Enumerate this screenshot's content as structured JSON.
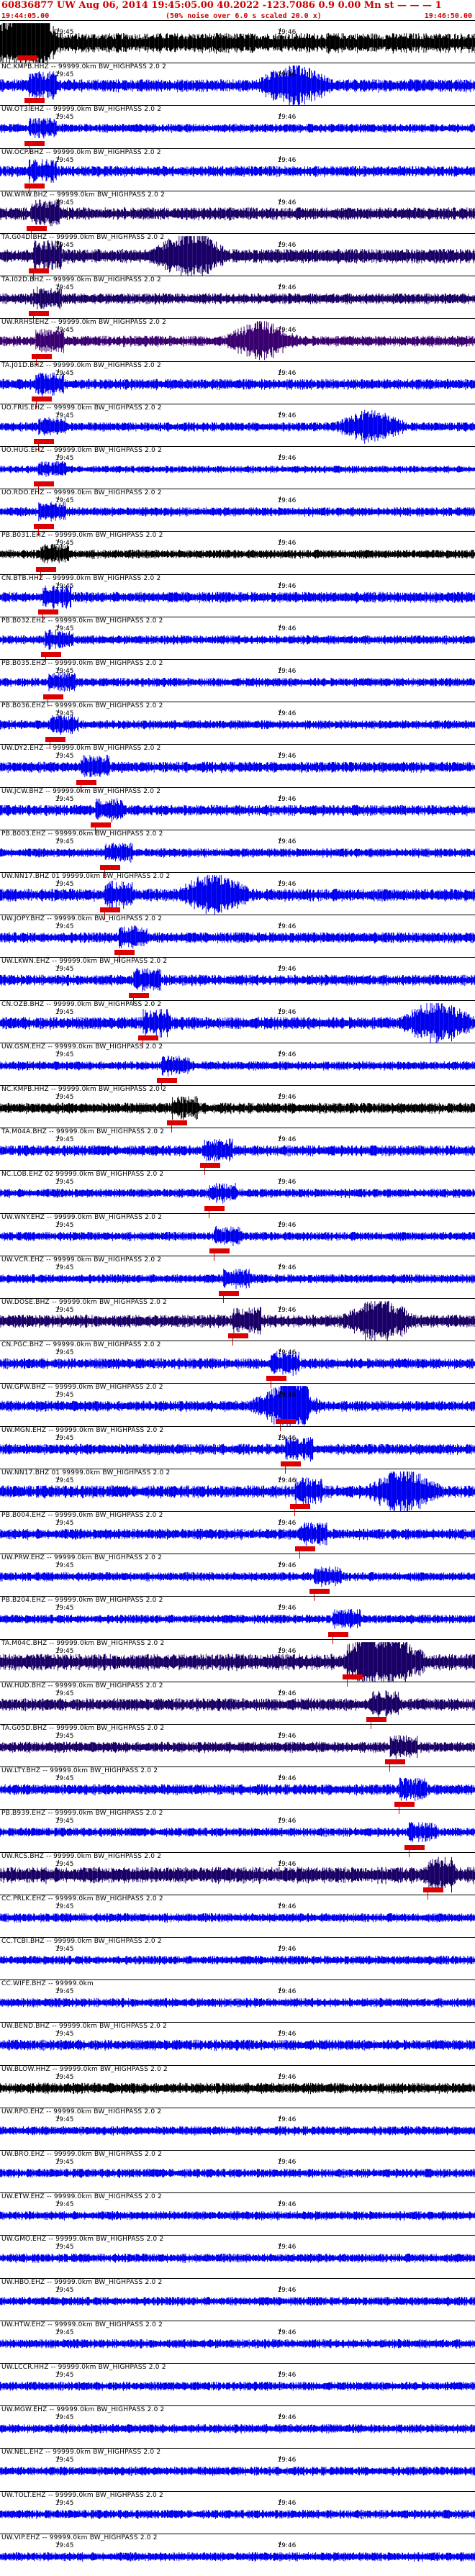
{
  "header": {
    "title": "60836877 UW Aug 06, 2014 19:45:05.00   40.2022 -123.7086  0.9 0.00 Mn st — — — 1",
    "start_time": "19:44:05.00",
    "note": "(50% noise over 6.0 s scaled 20.0 x)",
    "end_time": "19:46:50.00"
  },
  "tick_labels": {
    "first": "19:45",
    "second": "19:46"
  },
  "colors": {
    "black": "#000000",
    "blue": "#0000ee",
    "navy": "#1a0066",
    "purple": "#3a0070",
    "pick": "#dd0000"
  },
  "traces": [
    {
      "label": "",
      "color": "black",
      "amp": 0.55,
      "burst": 0.05,
      "pick": 0.045
    },
    {
      "label": "NC.KMPB.HHZ -- 99999.0km BW_HIGHPASS  2.0  2",
      "color": "blue",
      "amp": 0.35,
      "burst": 0.62,
      "pick": 0.06
    },
    {
      "label": "UW.OT3.EHZ -- 99999.0km BW_HIGHPASS  2.0  2",
      "color": "blue",
      "amp": 0.25,
      "burst": 0.0,
      "pick": 0.06
    },
    {
      "label": "UW.OCP.BHZ -- 99999.0km BW_HIGHPASS  2.0  2",
      "color": "blue",
      "amp": 0.3,
      "burst": 0.0,
      "pick": 0.06
    },
    {
      "label": "UW.WRW.BHZ -- 99999.0km BW_HIGHPASS  2.0  2",
      "color": "navy",
      "amp": 0.35,
      "burst": 0.0,
      "pick": 0.065
    },
    {
      "label": "TA.G04D.BHZ -- 99999.0km BW_HIGHPASS  2.0  2",
      "color": "navy",
      "amp": 0.4,
      "burst": 0.4,
      "pick": 0.07
    },
    {
      "label": "TA.I02D.BHZ -- 99999.0km BW_HIGHPASS  2.0  2",
      "color": "navy",
      "amp": 0.3,
      "burst": 0.0,
      "pick": 0.07
    },
    {
      "label": "UW.RRHS.EHZ -- 99999.0km BW_HIGHPASS  2.0  2",
      "color": "purple",
      "amp": 0.3,
      "burst": 0.55,
      "pick": 0.075
    },
    {
      "label": "TA.J01D.BHZ -- 99999.0km BW_HIGHPASS  2.0  2",
      "color": "blue",
      "amp": 0.3,
      "burst": 0.0,
      "pick": 0.075
    },
    {
      "label": "UO.FRIS.EHZ -- 99999.0km BW_HIGHPASS  2.0  2",
      "color": "blue",
      "amp": 0.25,
      "burst": 0.78,
      "pick": 0.08
    },
    {
      "label": "UO.HUG.EHZ -- 99999.0km BW_HIGHPASS  2.0  2",
      "color": "blue",
      "amp": 0.2,
      "burst": 0.0,
      "pick": 0.08
    },
    {
      "label": "UO.RDO.EHZ -- 99999.0km BW_HIGHPASS  2.0  2",
      "color": "blue",
      "amp": 0.25,
      "burst": 0.0,
      "pick": 0.08
    },
    {
      "label": "PB.B031.EHZ -- 99999.0km BW_HIGHPASS  2.0  2",
      "color": "black",
      "amp": 0.25,
      "burst": 0.0,
      "pick": 0.085
    },
    {
      "label": "CN.BTB.HHZ -- 99999.0km BW_HIGHPASS  2.0  2",
      "color": "blue",
      "amp": 0.3,
      "burst": 0.0,
      "pick": 0.09
    },
    {
      "label": "PB.B032.EHZ -- 99999.0km BW_HIGHPASS  2.0  2",
      "color": "blue",
      "amp": 0.25,
      "burst": 0.0,
      "pick": 0.095
    },
    {
      "label": "PB.B035.EHZ -- 99999.0km BW_HIGHPASS  2.0  2",
      "color": "blue",
      "amp": 0.25,
      "burst": 0.0,
      "pick": 0.1
    },
    {
      "label": "PB.B036.EHZ -- 99999.0km BW_HIGHPASS  2.0  2",
      "color": "blue",
      "amp": 0.25,
      "burst": 0.0,
      "pick": 0.105
    },
    {
      "label": "UW.DY2.EHZ -- 99999.0km BW_HIGHPASS  2.0  2",
      "color": "blue",
      "amp": 0.3,
      "burst": 0.0,
      "pick": 0.17
    },
    {
      "label": "UW.JCW.BHZ -- 99999.0km BW_HIGHPASS  2.0  2",
      "color": "blue",
      "amp": 0.3,
      "burst": 0.0,
      "pick": 0.2
    },
    {
      "label": "PB.B003.EHZ -- 99999.0km BW_HIGHPASS  2.0  2",
      "color": "blue",
      "amp": 0.25,
      "burst": 0.0,
      "pick": 0.22
    },
    {
      "label": "UW.NN17.BHZ 01 99999.0km BW_HIGHPASS  2.0  2",
      "color": "blue",
      "amp": 0.35,
      "burst": 0.45,
      "pick": 0.22
    },
    {
      "label": "UW.JOPY.BHZ -- 99999.0km BW_HIGHPASS  2.0  2",
      "color": "blue",
      "amp": 0.3,
      "burst": 0.0,
      "pick": 0.25
    },
    {
      "label": "UW.LKWN.EHZ -- 99999.0km BW_HIGHPASS  2.0  2",
      "color": "blue",
      "amp": 0.3,
      "burst": 0.0,
      "pick": 0.28
    },
    {
      "label": "CN.OZB.BHZ -- 99999.0km BW_HIGHPASS  2.0  2",
      "color": "blue",
      "amp": 0.35,
      "burst": 0.92,
      "pick": 0.3
    },
    {
      "label": "UW.GSM.EHZ -- 99999.0km BW_HIGHPASS  2.0  2",
      "color": "blue",
      "amp": 0.25,
      "burst": 0.0,
      "pick": 0.34
    },
    {
      "label": "NC.KMPB.HHZ -- 99999.0km BW_HIGHPASS  2.0  2",
      "color": "black",
      "amp": 0.3,
      "burst": 0.0,
      "pick": 0.36
    },
    {
      "label": "TA.M04A.BHZ -- 99999.0km BW_HIGHPASS  2.0  2",
      "color": "blue",
      "amp": 0.3,
      "burst": 0.0,
      "pick": 0.43
    },
    {
      "label": "NC.LOB.EHZ 02 99999.0km BW_HIGHPASS  2.0  2",
      "color": "blue",
      "amp": 0.25,
      "burst": 0.0,
      "pick": 0.44
    },
    {
      "label": "UW.WNY.EHZ -- 99999.0km BW_HIGHPASS  2.0  2",
      "color": "blue",
      "amp": 0.25,
      "burst": 0.0,
      "pick": 0.45
    },
    {
      "label": "UW.VCR.EHZ -- 99999.0km BW_HIGHPASS  2.0  2",
      "color": "blue",
      "amp": 0.25,
      "burst": 0.0,
      "pick": 0.47
    },
    {
      "label": "UW.DOSE.BHZ -- 99999.0km BW_HIGHPASS  2.0  2",
      "color": "navy",
      "amp": 0.35,
      "burst": 0.8,
      "pick": 0.49
    },
    {
      "label": "CN.PGC.BHZ -- 99999.0km BW_HIGHPASS  2.0  2",
      "color": "blue",
      "amp": 0.3,
      "burst": 0.0,
      "pick": 0.57
    },
    {
      "label": "UW.GPW.BHZ -- 99999.0km BW_HIGHPASS  2.0  2",
      "color": "blue",
      "amp": 0.3,
      "burst": 0.6,
      "pick": 0.59
    },
    {
      "label": "UW.MGN.EHZ -- 99999.0km BW_HIGHPASS  2.0  2",
      "color": "blue",
      "amp": 0.3,
      "burst": 0.0,
      "pick": 0.6
    },
    {
      "label": "UW.NN17.BHZ 01 99999.0km BW_HIGHPASS  2.0  2",
      "color": "blue",
      "amp": 0.35,
      "burst": 0.85,
      "pick": 0.62
    },
    {
      "label": "PB.B004.EHZ -- 99999.0km BW_HIGHPASS  2.0  2",
      "color": "blue",
      "amp": 0.3,
      "burst": 0.0,
      "pick": 0.63
    },
    {
      "label": "UW.PRW.EHZ -- 99999.0km BW_HIGHPASS  2.0  2",
      "color": "blue",
      "amp": 0.25,
      "burst": 0.0,
      "pick": 0.66
    },
    {
      "label": "PB.B204.EHZ -- 99999.0km BW_HIGHPASS  2.0  2",
      "color": "blue",
      "amp": 0.25,
      "burst": 0.0,
      "pick": 0.7
    },
    {
      "label": "TA.M04C.BHZ -- 99999.0km BW_HIGHPASS  2.0  2",
      "color": "navy",
      "amp": 0.45,
      "burst": 0.82,
      "pick": 0.73
    },
    {
      "label": "UW.HUD.BHZ -- 99999.0km BW_HIGHPASS  2.0  2",
      "color": "navy",
      "amp": 0.35,
      "burst": 0.0,
      "pick": 0.78
    },
    {
      "label": "TA.G05D.BHZ -- 99999.0km BW_HIGHPASS  2.0  2",
      "color": "navy",
      "amp": 0.3,
      "burst": 0.0,
      "pick": 0.82
    },
    {
      "label": "UW.LTY.BHZ -- 99999.0km BW_HIGHPASS  2.0  2",
      "color": "blue",
      "amp": 0.3,
      "burst": 0.0,
      "pick": 0.84
    },
    {
      "label": "PB.B939.EHZ -- 99999.0km BW_HIGHPASS  2.0  2",
      "color": "blue",
      "amp": 0.25,
      "burst": 0.0,
      "pick": 0.86
    },
    {
      "label": "UW.RCS.BHZ -- 99999.0km BW_HIGHPASS  2.0  2",
      "color": "navy",
      "amp": 0.45,
      "burst": 0.0,
      "pick": 0.9
    },
    {
      "label": "CC.PRLK.EHZ -- 99999.0km BW_HIGHPASS  2.0  2",
      "color": "blue",
      "amp": 0.25,
      "burst": 0.0,
      "pick": -1
    },
    {
      "label": "CC.TCBI.BHZ -- 99999.0km BW_HIGHPASS  2.0  2",
      "color": "blue",
      "amp": 0.25,
      "burst": 0.0,
      "pick": -1
    },
    {
      "label": "CC.WIFE.BHZ -- 99999.0km",
      "color": "blue",
      "amp": 0.25,
      "burst": 0.0,
      "pick": -1
    },
    {
      "label": "UW.BEND.BHZ -- 99999.0km BW_HIGHPASS  2.0  2",
      "color": "blue",
      "amp": 0.3,
      "burst": 0.0,
      "pick": -1
    },
    {
      "label": "UW.BLOW.HHZ -- 99999.0km BW_HIGHPASS  2.0  2",
      "color": "black",
      "amp": 0.3,
      "burst": 0.0,
      "pick": -1
    },
    {
      "label": "UW.RPO.EHZ -- 99999.0km BW_HIGHPASS  2.0  2",
      "color": "blue",
      "amp": 0.25,
      "burst": 0.0,
      "pick": -1
    },
    {
      "label": "UW.BRO.EHZ -- 99999.0km BW_HIGHPASS  2.0  2",
      "color": "blue",
      "amp": 0.25,
      "burst": 0.0,
      "pick": -1
    },
    {
      "label": "UW.ETW.EHZ -- 99999.0km BW_HIGHPASS  2.0  2",
      "color": "blue",
      "amp": 0.25,
      "burst": 0.0,
      "pick": -1
    },
    {
      "label": "UW.GMO.EHZ -- 99999.0km BW_HIGHPASS  2.0  2",
      "color": "blue",
      "amp": 0.25,
      "burst": 0.0,
      "pick": -1
    },
    {
      "label": "UW.HBO.EHZ -- 99999.0km BW_HIGHPASS  2.0  2",
      "color": "blue",
      "amp": 0.25,
      "burst": 0.0,
      "pick": -1
    },
    {
      "label": "UW.HTW.EHZ -- 99999.0km BW_HIGHPASS  2.0  2",
      "color": "blue",
      "amp": 0.25,
      "burst": 0.0,
      "pick": -1
    },
    {
      "label": "UW.LCCR.HHZ -- 99999.0km BW_HIGHPASS  2.0  2",
      "color": "blue",
      "amp": 0.25,
      "burst": 0.0,
      "pick": -1
    },
    {
      "label": "UW.MGW.EHZ -- 99999.0km BW_HIGHPASS  2.0  2",
      "color": "blue",
      "amp": 0.25,
      "burst": 0.0,
      "pick": -1
    },
    {
      "label": "UW.NEL.EHZ -- 99999.0km BW_HIGHPASS  2.0  2",
      "color": "blue",
      "amp": 0.25,
      "burst": 0.0,
      "pick": -1
    },
    {
      "label": "UW.TOLT.EHZ -- 99999.0km BW_HIGHPASS  2.0  2",
      "color": "blue",
      "amp": 0.25,
      "burst": 0.0,
      "pick": -1
    },
    {
      "label": "UW.VIP.EHZ -- 99999.0km BW_HIGHPASS  2.0  2",
      "color": "blue",
      "amp": 0.25,
      "burst": 0.0,
      "pick": -1
    }
  ]
}
